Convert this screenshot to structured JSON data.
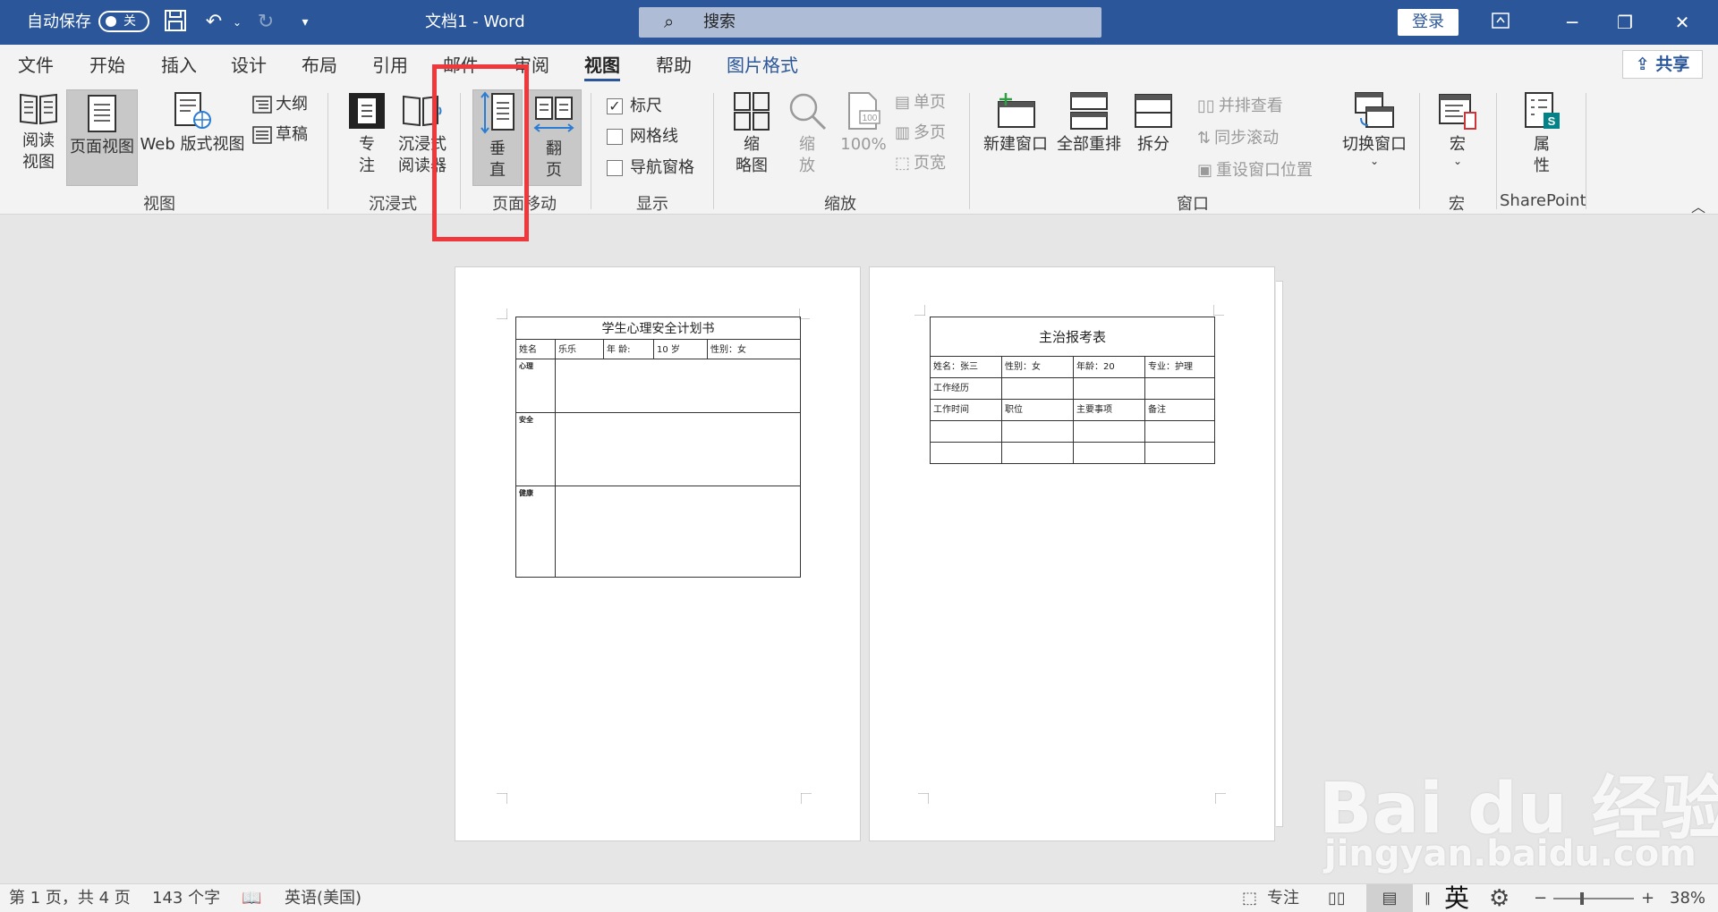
{
  "titlebar": {
    "autosave_label": "自动保存",
    "autosave_state": "关",
    "doc_title": "文档1  -  Word",
    "search_placeholder": "搜索",
    "login_label": "登录"
  },
  "menu": {
    "tabs": [
      "文件",
      "开始",
      "插入",
      "设计",
      "布局",
      "引用",
      "邮件",
      "审阅",
      "视图",
      "帮助",
      "图片格式"
    ],
    "active_tab": "视图",
    "share_label": "共享"
  },
  "ribbon": {
    "view_group": {
      "read_mode": "阅读\n视图",
      "print_layout": "页面视图",
      "web_layout": "Web 版式视图",
      "outline": "大纲",
      "draft": "草稿",
      "label": "视图"
    },
    "immersive_group": {
      "focus": "专\n注",
      "immersive_reader": "沉浸式\n阅读器",
      "label": "沉浸式"
    },
    "page_movement_group": {
      "vertical": "垂\n直",
      "side_to_side": "翻\n页",
      "label": "页面移动"
    },
    "show_group": {
      "ruler": "标尺",
      "ruler_checked": true,
      "gridlines": "网格线",
      "gridlines_checked": false,
      "nav_pane": "导航窗格",
      "nav_pane_checked": false,
      "label": "显示"
    },
    "zoom_group": {
      "thumbnails": "缩\n略图",
      "zoom": "缩\n放",
      "hundred": "100%",
      "hundred_icon_text": "100",
      "one_page": "单页",
      "multi_page": "多页",
      "page_width": "页宽",
      "label": "缩放"
    },
    "window_group": {
      "new_window": "新建窗口",
      "arrange_all": "全部重排",
      "split": "拆分",
      "side_by_side": "并排查看",
      "sync_scroll": "同步滚动",
      "reset_pos": "重设窗口位置",
      "switch_windows": "切换窗口",
      "label": "窗口"
    },
    "macros_group": {
      "macros": "宏",
      "label": "宏"
    },
    "sharepoint_group": {
      "properties": "属\n性",
      "label": "SharePoint"
    }
  },
  "pages": {
    "page1": {
      "title": "学生心理安全计划书",
      "row1": [
        "姓名",
        "乐乐",
        "年  龄:",
        "10 岁",
        "性别：女"
      ],
      "sections": [
        "心理",
        "安全",
        "健康"
      ]
    },
    "page2": {
      "title": "主治报考表",
      "row1": [
        "姓名：张三",
        "性别：女",
        "年龄：20",
        "专业：护理"
      ],
      "row2": [
        "工作经历"
      ],
      "row3": [
        "工作时间",
        "职位",
        "主要事项",
        "备注"
      ]
    }
  },
  "status": {
    "page_info": "第 1 页，共 4 页",
    "word_count": "143 个字",
    "language": "英语(美国)",
    "focus": "专注",
    "ime": "英",
    "zoom": "38%"
  },
  "watermark": {
    "logo": "Bai du 经验",
    "url": "jingyan.baidu.com"
  },
  "colors": {
    "word_blue": "#2b579a",
    "highlight_red": "#f0383c",
    "ribbon_bg": "#f3f3f3"
  }
}
